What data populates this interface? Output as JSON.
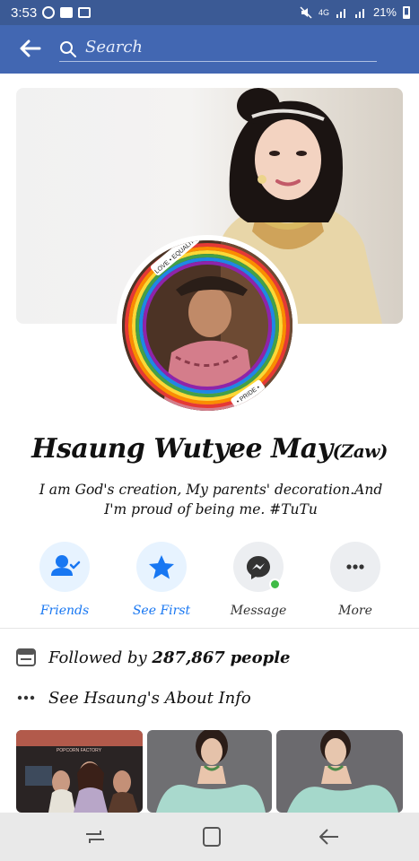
{
  "status_bar": {
    "time": "3:53",
    "network": "4G",
    "battery_percent": "21%"
  },
  "search": {
    "placeholder": "Search"
  },
  "profile": {
    "name": "Hsaung Wutyee May",
    "name_suffix": "(Zaw)",
    "bio": "I am God's creation, My parents' decoration.And I'm proud of being me. #TuTu",
    "frame_text_top": "LOVE • EQUALITY",
    "frame_text_bottom": "• PRIDE •"
  },
  "actions": [
    {
      "label": "Friends",
      "icon": "friends-check-icon",
      "color": "#1877f2"
    },
    {
      "label": "See First",
      "icon": "star-icon",
      "color": "#1877f2"
    },
    {
      "label": "Message",
      "icon": "messenger-icon",
      "color": "#333333"
    },
    {
      "label": "More",
      "icon": "more-dots-icon",
      "color": "#333333"
    }
  ],
  "info": {
    "followed_prefix": "Followed by",
    "followed_count": "287,867",
    "followed_suffix": "people",
    "about_link": "See Hsaung's About Info"
  },
  "photos": {
    "first_photo_caption": "POPCORN FACTORY"
  },
  "colors": {
    "header_blue": "#4267b2",
    "status_blue": "#3b5a95",
    "accent_blue": "#1877f2",
    "online_green": "#3fbb46"
  }
}
